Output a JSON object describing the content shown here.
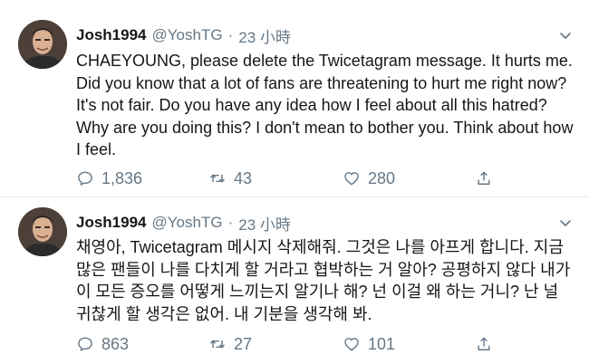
{
  "tweets": [
    {
      "display_name": "Josh1994",
      "handle": "@YoshTG",
      "separator": "·",
      "time": "23 小時",
      "text": "CHAEYOUNG, please delete the Twicetagram message. It hurts me. Did you know that a lot of fans are threatening to hurt me right now? It's not fair. Do you have any idea how I feel about all this hatred? Why are you doing this? I don't mean to bother you. Think about how I feel.",
      "replies": "1,836",
      "retweets": "43",
      "likes": "280"
    },
    {
      "display_name": "Josh1994",
      "handle": "@YoshTG",
      "separator": "·",
      "time": "23 小時",
      "text": "채영아, Twicetagram 메시지 삭제해줘. 그것은 나를 아프게 합니다. 지금 많은 팬들이 나를 다치게 할 거라고 협박하는 거 알아? 공평하지 않다 내가 이 모든 증오를 어떻게 느끼는지 알기나 해? 넌 이걸 왜 하는 거니? 난 널 귀찮게 할 생각은 없어. 내 기분을 생각해 봐.",
      "replies": "863",
      "retweets": "27",
      "likes": "101"
    }
  ],
  "colors": {
    "text": "#14171a",
    "secondary": "#657786",
    "divider": "#e6ecf0"
  }
}
